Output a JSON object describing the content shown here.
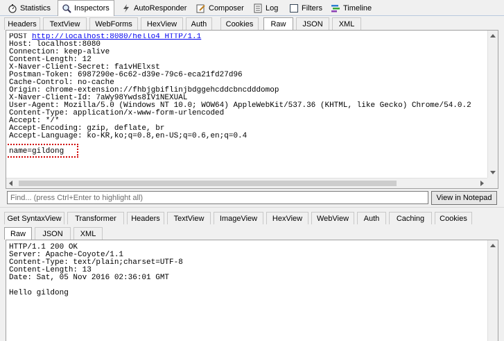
{
  "top_tabs": [
    {
      "label": "Statistics",
      "icon": "stopwatch-icon"
    },
    {
      "label": "Inspectors",
      "icon": "magnifier-icon"
    },
    {
      "label": "AutoResponder",
      "icon": "lightning-icon"
    },
    {
      "label": "Composer",
      "icon": "pencil-icon"
    },
    {
      "label": "Log",
      "icon": "log-icon"
    },
    {
      "label": "Filters",
      "icon": "checkbox-icon"
    },
    {
      "label": "Timeline",
      "icon": "timeline-icon"
    }
  ],
  "request": {
    "tabs_row1": [
      "Headers",
      "TextView",
      "WebForms",
      "HexView",
      "Auth",
      "Cookies",
      "Raw",
      "JSON",
      "XML"
    ],
    "active_tab": "Raw",
    "request_line_method": "POST ",
    "request_line_url": "http://localhost:8080/hello4 HTTP/1.1",
    "header_lines": [
      "Host: localhost:8080",
      "Connection: keep-alive",
      "Content-Length: 12",
      "X-Naver-Client-Secret: fa1vHElxst",
      "Postman-Token: 6987290e-6c62-d39e-79c6-eca21fd27d96",
      "Cache-Control: no-cache",
      "Origin: chrome-extension://fhbjgbiflinjbdggehcddcbncdddomop",
      "X-Naver-Client-Id: 7aWy98Ywds8IV1NEXUAL",
      "User-Agent: Mozilla/5.0 (Windows NT 10.0; WOW64) AppleWebKit/537.36 (KHTML, like Gecko) Chrome/54.0.2",
      "Content-Type: application/x-www-form-urlencoded",
      "Accept: */*",
      "Accept-Encoding: gzip, deflate, br",
      "Accept-Language: ko-KR,ko;q=0.8,en-US;q=0.6,en;q=0.4"
    ],
    "body": "name=gildong"
  },
  "find": {
    "placeholder": "Find... (press Ctrl+Enter to highlight all)",
    "button_label": "View in Notepad"
  },
  "response": {
    "tabs_row1": [
      "Get SyntaxView",
      "Transformer",
      "Headers",
      "TextView",
      "ImageView",
      "HexView",
      "WebView",
      "Auth",
      "Caching",
      "Cookies"
    ],
    "tabs_row2": [
      "Raw",
      "JSON",
      "XML"
    ],
    "active_tab": "Raw",
    "header_lines": [
      "HTTP/1.1 200 OK",
      "Server: Apache-Coyote/1.1",
      "Content-Type: text/plain;charset=UTF-8",
      "Content-Length: 13",
      "Date: Sat, 05 Nov 2016 02:36:01 GMT"
    ],
    "body": "Hello gildong"
  },
  "colors": {
    "highlight_border": "#d00000",
    "link": "#0000ee",
    "timeline_bars": [
      "#2f7fd0",
      "#39a935",
      "#8a3fb4"
    ]
  }
}
